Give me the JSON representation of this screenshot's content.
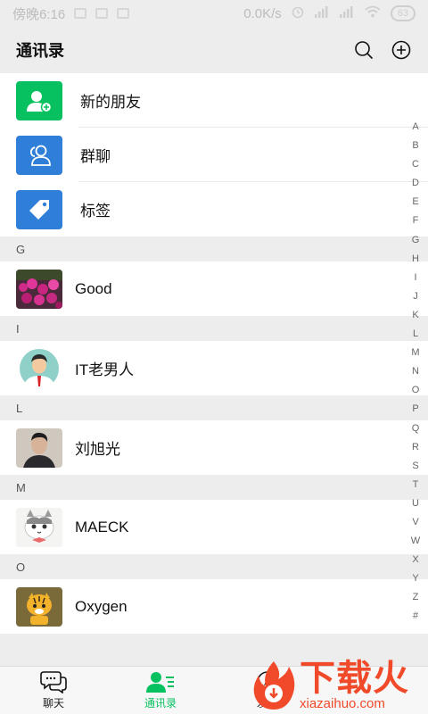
{
  "status_bar": {
    "time": "傍晚6:16",
    "speed": "0.0K/s",
    "battery": "63"
  },
  "header": {
    "title": "通讯录"
  },
  "functions": [
    {
      "label": "新的朋友",
      "icon": "add-friend-icon",
      "color": "#07c160"
    },
    {
      "label": "群聊",
      "icon": "group-chat-icon",
      "color": "#2f7fd8"
    },
    {
      "label": "标签",
      "icon": "tag-icon",
      "color": "#2f7fd8"
    }
  ],
  "sections": [
    {
      "letter": "G",
      "contacts": [
        {
          "name": "Good",
          "avatar": "flower-photo-avatar"
        }
      ]
    },
    {
      "letter": "I",
      "contacts": [
        {
          "name": "IT老男人",
          "avatar": "man-cartoon-avatar"
        }
      ]
    },
    {
      "letter": "L",
      "contacts": [
        {
          "name": "刘旭光",
          "avatar": "man-photo-avatar"
        }
      ]
    },
    {
      "letter": "M",
      "contacts": [
        {
          "name": "MAECK",
          "avatar": "cat-avatar"
        }
      ]
    },
    {
      "letter": "O",
      "contacts": [
        {
          "name": "Oxygen",
          "avatar": "tiger-avatar"
        }
      ]
    }
  ],
  "index": [
    "A",
    "B",
    "C",
    "D",
    "E",
    "F",
    "G",
    "H",
    "I",
    "J",
    "K",
    "L",
    "M",
    "N",
    "O",
    "P",
    "Q",
    "R",
    "S",
    "T",
    "U",
    "V",
    "W",
    "X",
    "Y",
    "Z",
    "#"
  ],
  "tabs": [
    {
      "label": "聊天",
      "icon": "chat-icon",
      "active": false
    },
    {
      "label": "通讯录",
      "icon": "contacts-icon",
      "active": true
    },
    {
      "label": "发现",
      "icon": "discover-icon",
      "active": false
    }
  ],
  "watermark": {
    "brand": "下载火",
    "url": "xiazaihuo.com"
  },
  "colors": {
    "accent": "#07c160",
    "blue": "#2f7fd8",
    "watermark": "#f04a2a"
  }
}
